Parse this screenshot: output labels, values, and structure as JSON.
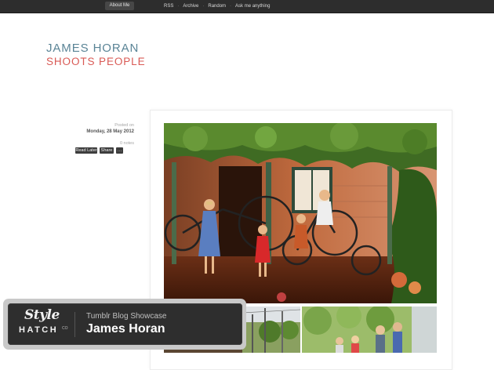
{
  "topbar": {
    "about_label": "About Me",
    "nav": [
      {
        "label": "RSS"
      },
      {
        "label": "Archive"
      },
      {
        "label": "Random"
      },
      {
        "label": "Ask me anything"
      }
    ],
    "separator": "·"
  },
  "logo": {
    "line1": "JAMES HORAN",
    "line2": "SHOOTS PEOPLE"
  },
  "post": {
    "posted_on": "Posted on",
    "date": "Monday, 28 May 2012",
    "notes": "0 notes",
    "actions": {
      "read_later": "Read Later",
      "share": "Share",
      "more": "…"
    }
  },
  "showcase": {
    "brand_style": "Style",
    "brand_hatch": "HATCH",
    "brand_co": "CO",
    "subtitle": "Tumblr Blog Showcase",
    "name": "James Horan"
  },
  "colors": {
    "topbar_bg": "#2d2d2d",
    "logo_blue": "#5a8496",
    "logo_red": "#d95a55",
    "button_dark": "#3d3d3d"
  }
}
